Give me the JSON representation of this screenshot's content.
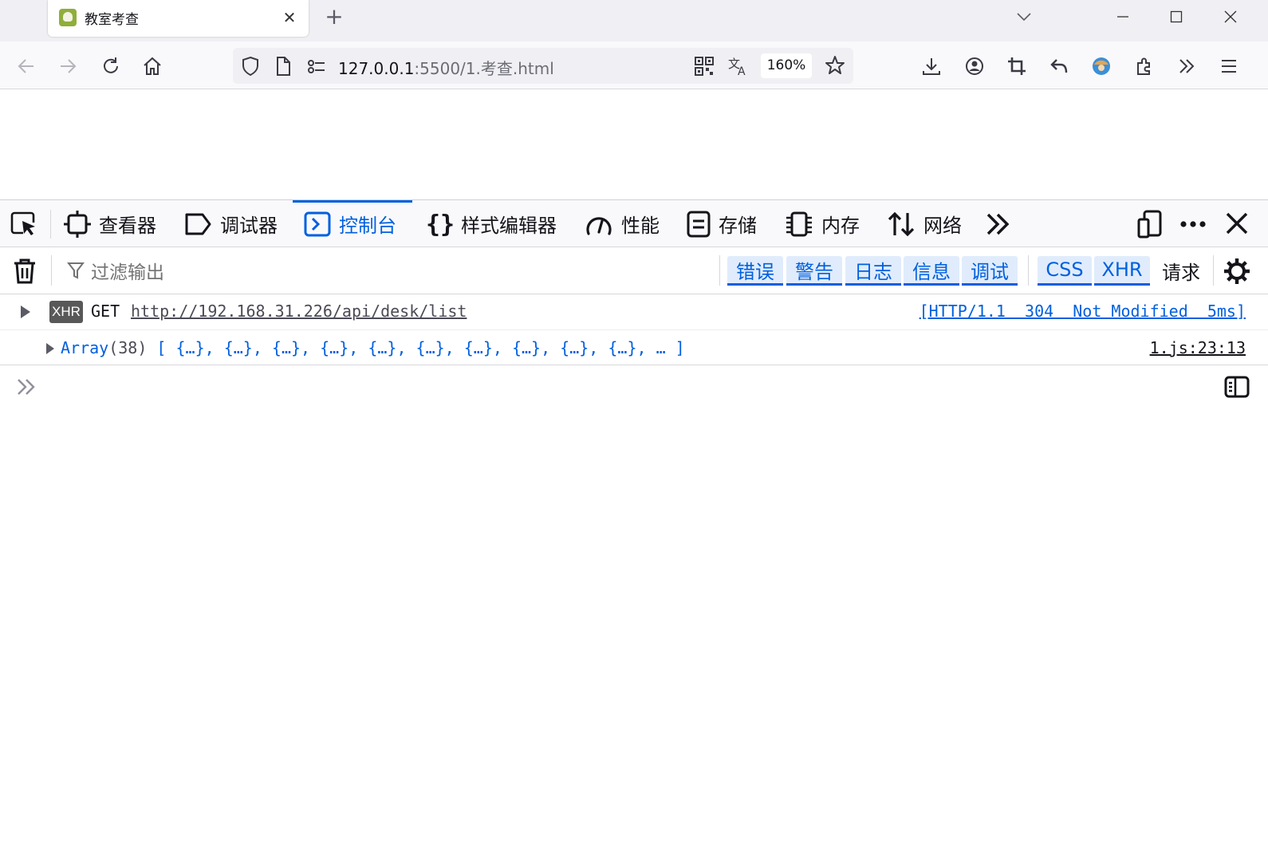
{
  "browser": {
    "tab": {
      "title": "教室考查",
      "favicon_icon": "skull-favicon-icon",
      "close_icon": "close-icon"
    },
    "new_tab_icon": "plus-icon",
    "window_controls": [
      "chevron-down-icon",
      "minimize-icon",
      "maximize-icon",
      "close-icon"
    ],
    "nav": {
      "back_icon": "back-arrow-icon",
      "forward_icon": "forward-arrow-icon",
      "reload_icon": "reload-icon",
      "home_icon": "home-icon"
    },
    "url": {
      "host": "127.0.0.1",
      "rest": ":5500/1.考查.html"
    },
    "zoom": "160%",
    "toolbar_icons": [
      "download-icon",
      "account-icon",
      "crop-icon",
      "undo-icon",
      "extension-avatar-icon",
      "puzzle-icon",
      "chevrons-right-icon",
      "hamburger-menu-icon"
    ]
  },
  "devtools": {
    "tabs": [
      {
        "label": "查看器",
        "icon": "inspector-icon"
      },
      {
        "label": "调试器",
        "icon": "debugger-icon"
      },
      {
        "label": "控制台",
        "icon": "console-icon",
        "selected": true
      },
      {
        "label": "样式编辑器",
        "icon": "braces-icon"
      },
      {
        "label": "性能",
        "icon": "gauge-icon"
      },
      {
        "label": "存储",
        "icon": "storage-icon"
      },
      {
        "label": "内存",
        "icon": "memory-chip-icon"
      },
      {
        "label": "网络",
        "icon": "arrows-updown-icon"
      }
    ],
    "filter": {
      "placeholder": "过滤输出",
      "chips": [
        "错误",
        "警告",
        "日志",
        "信息",
        "调试"
      ],
      "chips2": [
        "CSS",
        "XHR",
        "请求"
      ]
    },
    "console": {
      "request": {
        "badge": "XHR",
        "method": "GET",
        "url": "http://192.168.31.226/api/desk/list",
        "status": "[HTTP/1.1  304  Not Modified  5ms]"
      },
      "log": {
        "name": "Array",
        "count": "(38)",
        "items": " [ {…}, {…}, {…}, {…}, {…}, {…}, {…}, {…}, {…}, {…}, … ]",
        "source": "1.js:23:13"
      }
    }
  }
}
